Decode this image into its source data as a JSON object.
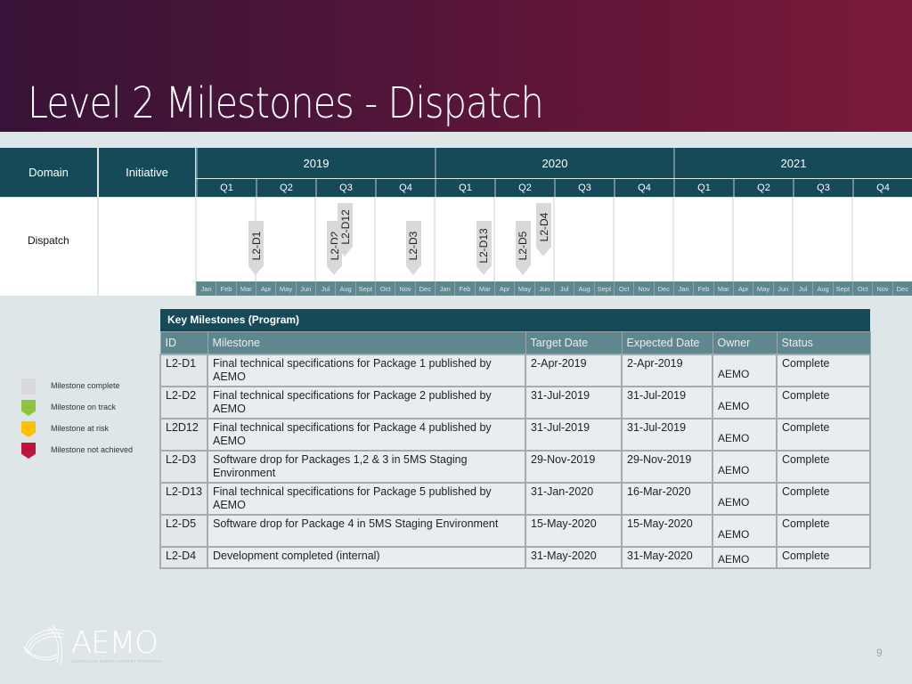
{
  "page": {
    "title": "Level 2 Milestones - Dispatch",
    "page_number": "9"
  },
  "colors": {
    "header_bg": "#164a59",
    "subheader_bg": "#5e8790",
    "milestone_complete": "#d9d9d9",
    "milestone_on_track": "#8cc63f",
    "milestone_at_risk": "#ffc000",
    "milestone_not_achieved": "#c0143c"
  },
  "chart_data": {
    "type": "table",
    "title": "Level 2 Milestones - Dispatch (timeline)",
    "headers": {
      "domain": "Domain",
      "initiative": "Initiative"
    },
    "years": [
      "2019",
      "2020",
      "2021"
    ],
    "quarters": [
      "Q1",
      "Q2",
      "Q3",
      "Q4"
    ],
    "months": [
      "Jan",
      "Feb",
      "Mar",
      "Apr",
      "May",
      "Jun",
      "Jul",
      "Aug",
      "Sept",
      "Oct",
      "Nov",
      "Dec"
    ],
    "rows": [
      {
        "domain": "Dispatch",
        "initiative": ""
      }
    ],
    "markers": [
      {
        "id": "L2-D1",
        "date": "2019-04-02",
        "status": "complete",
        "stack": 0
      },
      {
        "id": "L2-D2",
        "date": "2019-07-31",
        "status": "complete",
        "stack": 0
      },
      {
        "id": "L2-D12",
        "date": "2019-07-31",
        "status": "complete",
        "stack": 1
      },
      {
        "id": "L2-D3",
        "date": "2019-11-29",
        "status": "complete",
        "stack": 0
      },
      {
        "id": "L2-D13",
        "date": "2020-03-16",
        "status": "complete",
        "stack": 0
      },
      {
        "id": "L2-D5",
        "date": "2020-05-15",
        "status": "complete",
        "stack": 0
      },
      {
        "id": "L2-D4",
        "date": "2020-05-31",
        "status": "complete",
        "stack": 1
      }
    ],
    "range": [
      "2019-01-01",
      "2021-12-31"
    ]
  },
  "legend": [
    {
      "label": "Milestone complete",
      "status": "complete"
    },
    {
      "label": "Milestone on track",
      "status": "on_track"
    },
    {
      "label": "Milestone at risk",
      "status": "at_risk"
    },
    {
      "label": "Milestone not achieved",
      "status": "not_achieved"
    }
  ],
  "milestones_table": {
    "title": "Key Milestones (Program)",
    "columns": [
      "ID",
      "Milestone",
      "Target Date",
      "Expected Date",
      "Owner",
      "Status"
    ],
    "rows": [
      {
        "id": "L2-D1",
        "milestone": "Final technical specifications for Package 1 published by AEMO",
        "target": "2-Apr-2019",
        "expected": "2-Apr-2019",
        "owner": "AEMO",
        "status": "Complete"
      },
      {
        "id": "L2-D2",
        "milestone": "Final technical specifications for Package 2 published by AEMO",
        "target": "31-Jul-2019",
        "expected": "31-Jul-2019",
        "owner": "AEMO",
        "status": "Complete"
      },
      {
        "id": "L2D12",
        "milestone": "Final technical specifications for Package 4 published by AEMO",
        "target": "31-Jul-2019",
        "expected": "31-Jul-2019",
        "owner": "AEMO",
        "status": "Complete"
      },
      {
        "id": "L2-D3",
        "milestone": "Software drop for Packages 1,2 & 3 in 5MS Staging Environment",
        "target": "29-Nov-2019",
        "expected": "29-Nov-2019",
        "owner": "AEMO",
        "status": "Complete"
      },
      {
        "id": "L2-D13",
        "milestone": "Final technical specifications for Package 5 published by AEMO",
        "target": "31-Jan-2020",
        "expected": "16-Mar-2020",
        "owner": "AEMO",
        "status": "Complete"
      },
      {
        "id": "L2-D5",
        "milestone": "Software drop for Package 4 in 5MS Staging Environment",
        "target": "15-May-2020",
        "expected": "15-May-2020",
        "owner": "AEMO",
        "status": "Complete"
      },
      {
        "id": "L2-D4",
        "milestone": "Development completed (internal)",
        "target": "31-May-2020",
        "expected": "31-May-2020",
        "owner": "AEMO",
        "status": "Complete"
      }
    ]
  },
  "logo": {
    "name": "AEMO",
    "tagline": "AUSTRALIAN ENERGY MARKET OPERATOR"
  }
}
